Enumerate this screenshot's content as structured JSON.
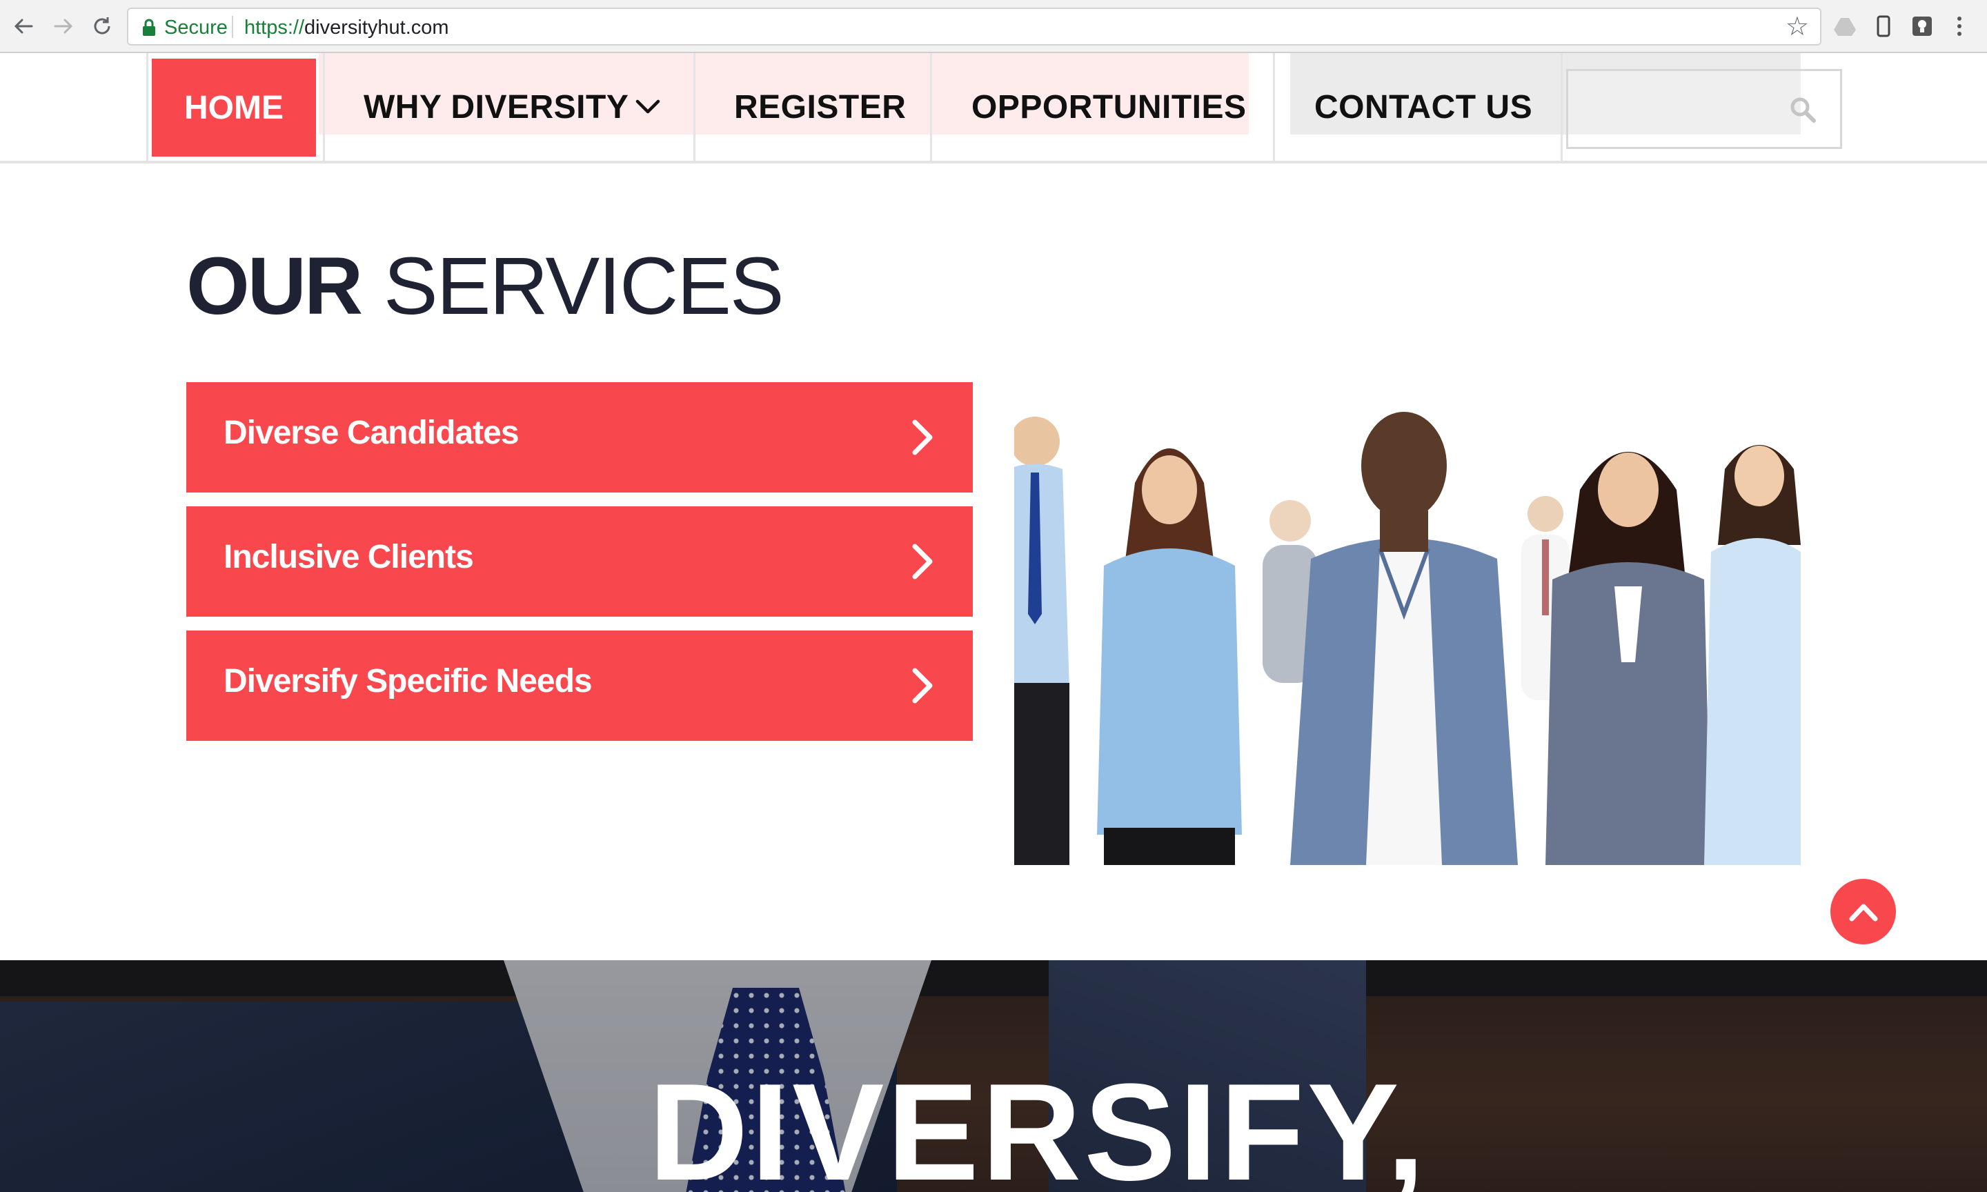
{
  "browser": {
    "secure_label": "Secure",
    "url_protocol": "https://",
    "url_host": "diversityhut.com"
  },
  "nav": {
    "home": "HOME",
    "why_diversity": "WHY DIVERSITY",
    "register": "REGISTER",
    "opportunities": "OPPORTUNITIES",
    "contact": "CONTACT US",
    "search_placeholder": ""
  },
  "services": {
    "title_bold": "OUR",
    "title_light": "SERVICES",
    "items": [
      {
        "label": "Diverse Candidates"
      },
      {
        "label": "Inclusive Clients"
      },
      {
        "label": "Diversify Specific Needs"
      }
    ]
  },
  "hero": {
    "headline": "DIVERSIFY,"
  },
  "colors": {
    "accent": "#f8474d",
    "title": "#1e2233",
    "secure_green": "#188038"
  },
  "icons": {
    "back": "arrow-left-icon",
    "forward": "arrow-right-icon",
    "reload": "reload-icon",
    "lock": "lock-icon",
    "bookmark": "star-icon",
    "search": "search-icon",
    "chevron": "chevron-right-icon",
    "scroll_top": "chevron-up-icon"
  }
}
